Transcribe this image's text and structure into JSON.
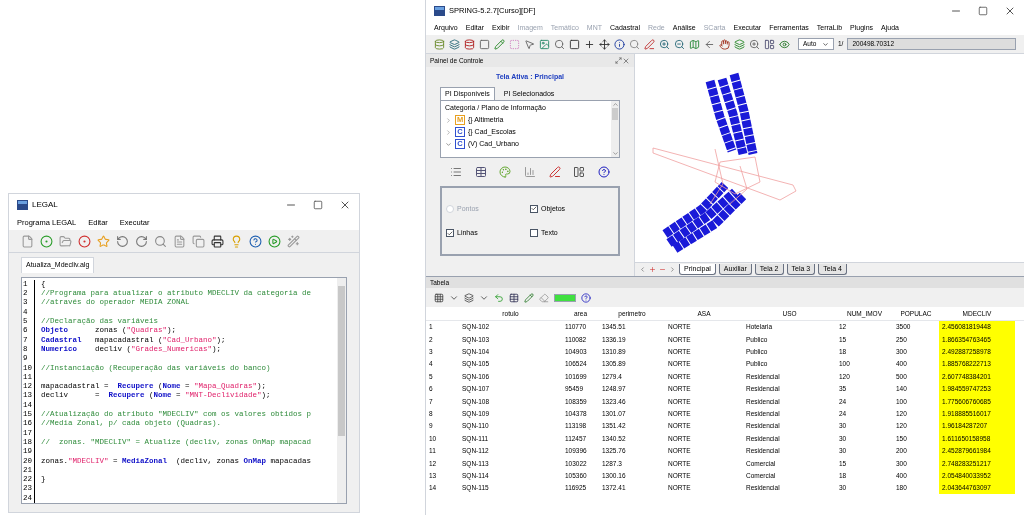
{
  "legal_window": {
    "title": "LEGAL",
    "menu": [
      "Programa LEGAL",
      "Editar",
      "Executar"
    ],
    "tab": "Atualiza_Mdecliv.alg",
    "code_lines": [
      {
        "number": "1",
        "segments": [
          {
            "kind": "plain",
            "text": "{"
          }
        ]
      },
      {
        "number": "2",
        "segments": [
          {
            "kind": "comment",
            "text": "//Programa para atualizar o atributo MDECLIV da categoria de"
          }
        ]
      },
      {
        "number": "3",
        "segments": [
          {
            "kind": "comment",
            "text": "//através do operador MEDIA ZONAL"
          }
        ]
      },
      {
        "number": "4"
      },
      {
        "number": "5",
        "segments": [
          {
            "kind": "comment",
            "text": "//Declaração das variáveis"
          }
        ]
      },
      {
        "number": "6",
        "segments": [
          {
            "kind": "keyword",
            "text": "Objeto"
          },
          {
            "kind": "plain",
            "text": "      zonas ("
          },
          {
            "kind": "string",
            "text": "\"Quadras\""
          },
          {
            "kind": "plain",
            "text": ");"
          }
        ]
      },
      {
        "number": "7",
        "segments": [
          {
            "kind": "keyword",
            "text": "Cadastral"
          },
          {
            "kind": "plain",
            "text": "   mapacadastral ("
          },
          {
            "kind": "string",
            "text": "\"Cad_Urbano\""
          },
          {
            "kind": "plain",
            "text": ");"
          }
        ]
      },
      {
        "number": "8",
        "segments": [
          {
            "kind": "keyword",
            "text": "Numerico"
          },
          {
            "kind": "plain",
            "text": "    decliv ("
          },
          {
            "kind": "string",
            "text": "\"Grades_Numericas\""
          },
          {
            "kind": "plain",
            "text": ");"
          }
        ]
      },
      {
        "number": "9"
      },
      {
        "number": "10",
        "segments": [
          {
            "kind": "comment",
            "text": "//Instanciação (Recuperação das variáveis do banco)"
          }
        ]
      },
      {
        "number": "11"
      },
      {
        "number": "12",
        "segments": [
          {
            "kind": "plain",
            "text": "mapacadastral =  "
          },
          {
            "kind": "keyword",
            "text": "Recupere"
          },
          {
            "kind": "plain",
            "text": " ("
          },
          {
            "kind": "keyword",
            "text": "Nome"
          },
          {
            "kind": "plain",
            "text": " = "
          },
          {
            "kind": "string",
            "text": "\"Mapa_Quadras\""
          },
          {
            "kind": "plain",
            "text": ");"
          }
        ]
      },
      {
        "number": "13",
        "segments": [
          {
            "kind": "plain",
            "text": "decliv      =  "
          },
          {
            "kind": "keyword",
            "text": "Recupere"
          },
          {
            "kind": "plain",
            "text": " ("
          },
          {
            "kind": "keyword",
            "text": "Nome"
          },
          {
            "kind": "plain",
            "text": " = "
          },
          {
            "kind": "string",
            "text": "\"MNT-Declividade\""
          },
          {
            "kind": "plain",
            "text": ");"
          }
        ]
      },
      {
        "number": "14"
      },
      {
        "number": "15",
        "segments": [
          {
            "kind": "comment",
            "text": "//Atualização do atributo \"MDECLIV\" com os valores obtidos p"
          }
        ]
      },
      {
        "number": "16",
        "segments": [
          {
            "kind": "comment",
            "text": "//Media Zonal, p/ cada objeto (Quadras)."
          }
        ]
      },
      {
        "number": "17"
      },
      {
        "number": "18",
        "segments": [
          {
            "kind": "comment",
            "text": "//  zonas. \"MDECLIV\" = Atualize (decliv, zonas OnMap mapacad"
          }
        ]
      },
      {
        "number": "19"
      },
      {
        "number": "20",
        "segments": [
          {
            "kind": "plain",
            "text": "zonas."
          },
          {
            "kind": "string",
            "text": "\"MDECLIV\""
          },
          {
            "kind": "plain",
            "text": " = "
          },
          {
            "kind": "keyword",
            "text": "MediaZonal"
          },
          {
            "kind": "plain",
            "text": "  (decliv, zonas "
          },
          {
            "kind": "keyword",
            "text": "OnMap"
          },
          {
            "kind": "plain",
            "text": " mapacadas"
          }
        ]
      },
      {
        "number": "21"
      },
      {
        "number": "22",
        "segments": [
          {
            "kind": "plain",
            "text": "}"
          }
        ]
      },
      {
        "number": "23"
      },
      {
        "number": "24"
      }
    ]
  },
  "spring_window": {
    "title": "SPRING-5.2.7[Curso][DF]",
    "menu": [
      {
        "label": "Arquivo",
        "disabled": false
      },
      {
        "label": "Editar",
        "disabled": false
      },
      {
        "label": "Exibir",
        "disabled": false
      },
      {
        "label": "Imagem",
        "disabled": true
      },
      {
        "label": "Temático",
        "disabled": true
      },
      {
        "label": "MNT",
        "disabled": true
      },
      {
        "label": "Cadastral",
        "disabled": false
      },
      {
        "label": "Rede",
        "disabled": true
      },
      {
        "label": "Análise",
        "disabled": false
      },
      {
        "label": "SCarta",
        "disabled": true
      },
      {
        "label": "Executar",
        "disabled": false
      },
      {
        "label": "Ferramentas",
        "disabled": false
      },
      {
        "label": "TerraLib",
        "disabled": false
      },
      {
        "label": "Plugins",
        "disabled": false
      },
      {
        "label": "Ajuda",
        "disabled": false
      }
    ],
    "toolbar": {
      "scale_mode": "Auto",
      "scale_prefix": "1/",
      "scale_value": "200498.70312"
    },
    "control_panel": {
      "title": "Painel de Controle",
      "active_screen": "Tela Ativa : Principal",
      "tabs": [
        {
          "label": "PI Disponíveis",
          "selected": true
        },
        {
          "label": "PI Selecionados",
          "selected": false
        }
      ],
      "tree_header": "Categoria / Plano de Informação",
      "tree_items": [
        {
          "badge": "M",
          "color": "#e8a020",
          "label": "{} Altimetria",
          "expanded": false
        },
        {
          "badge": "C",
          "color": "#3050d0",
          "label": "{} Cad_Escolas",
          "expanded": false
        },
        {
          "badge": "C",
          "color": "#3050d0",
          "label": "(V) Cad_Urbano",
          "expanded": true
        }
      ],
      "options": [
        {
          "kind": "radio",
          "label": "Pontos",
          "checked": false,
          "disabled": true
        },
        {
          "kind": "checkbox",
          "label": "Objetos",
          "checked": true,
          "disabled": false
        },
        {
          "kind": "checkbox",
          "label": "Linhas",
          "checked": true,
          "disabled": false
        },
        {
          "kind": "checkbox",
          "label": "Texto",
          "checked": false,
          "disabled": false
        }
      ]
    },
    "map": {
      "tabs": [
        {
          "label": "Principal",
          "selected": true
        },
        {
          "label": "Auxiliar",
          "selected": false
        },
        {
          "label": "Tela 2",
          "selected": false
        },
        {
          "label": "Tela 3",
          "selected": false
        },
        {
          "label": "Tela 4",
          "selected": false
        }
      ]
    },
    "table": {
      "title": "Tabela",
      "columns": [
        {
          "label": "rotulo",
          "highlighted": false
        },
        {
          "label": "area",
          "highlighted": false
        },
        {
          "label": "perimetro",
          "highlighted": false
        },
        {
          "label": "ASA",
          "highlighted": false
        },
        {
          "label": "USO",
          "highlighted": false
        },
        {
          "label": "NUM_IMOV",
          "highlighted": false
        },
        {
          "label": "POPULAC",
          "highlighted": false
        },
        {
          "label": "MDECLIV",
          "highlighted": true
        }
      ],
      "rows": [
        {
          "index": "1",
          "cells": [
            "SQN-102",
            "110770",
            "1345.51",
            "NORTE",
            "Hotelaria",
            "12",
            "3500",
            "2.456081819448"
          ]
        },
        {
          "index": "2",
          "cells": [
            "SQN-103",
            "110082",
            "1336.19",
            "NORTE",
            "Publico",
            "15",
            "250",
            "1.866354763465"
          ]
        },
        {
          "index": "3",
          "cells": [
            "SQN-104",
            "104903",
            "1310.89",
            "NORTE",
            "Publico",
            "18",
            "300",
            "2.492887258978"
          ]
        },
        {
          "index": "4",
          "cells": [
            "SQN-105",
            "106524",
            "1305.89",
            "NORTE",
            "Publico",
            "100",
            "400",
            "1.885768222713"
          ]
        },
        {
          "index": "5",
          "cells": [
            "SQN-106",
            "101699",
            "1279.4",
            "NORTE",
            "Residencial",
            "120",
            "500",
            "2.607748384201"
          ]
        },
        {
          "index": "6",
          "cells": [
            "SQN-107",
            "95459",
            "1248.97",
            "NORTE",
            "Residencial",
            "35",
            "140",
            "1.984559747253"
          ]
        },
        {
          "index": "7",
          "cells": [
            "SQN-108",
            "108359",
            "1323.46",
            "NORTE",
            "Residencial",
            "24",
            "100",
            "1.775606760685"
          ]
        },
        {
          "index": "8",
          "cells": [
            "SQN-109",
            "104378",
            "1301.07",
            "NORTE",
            "Residencial",
            "24",
            "120",
            "1.918885516017"
          ]
        },
        {
          "index": "9",
          "cells": [
            "SQN-110",
            "113198",
            "1351.42",
            "NORTE",
            "Residencial",
            "30",
            "120",
            "1.96184287207"
          ]
        },
        {
          "index": "10",
          "cells": [
            "SQN-111",
            "112457",
            "1340.52",
            "NORTE",
            "Residencial",
            "30",
            "150",
            "1.611650158958"
          ]
        },
        {
          "index": "11",
          "cells": [
            "SQN-112",
            "109396",
            "1325.76",
            "NORTE",
            "Residencial",
            "30",
            "200",
            "2.452879661984"
          ]
        },
        {
          "index": "12",
          "cells": [
            "SQN-113",
            "103022",
            "1287.3",
            "NORTE",
            "Comercial",
            "15",
            "300",
            "2.748283251217"
          ]
        },
        {
          "index": "13",
          "cells": [
            "SQN-114",
            "105360",
            "1300.16",
            "NORTE",
            "Comercial",
            "18",
            "400",
            "2.054840033952"
          ]
        },
        {
          "index": "14",
          "cells": [
            "SQN-115",
            "116925",
            "1372.41",
            "NORTE",
            "Residencial",
            "30",
            "180",
            "2.043644763097"
          ]
        }
      ]
    }
  }
}
